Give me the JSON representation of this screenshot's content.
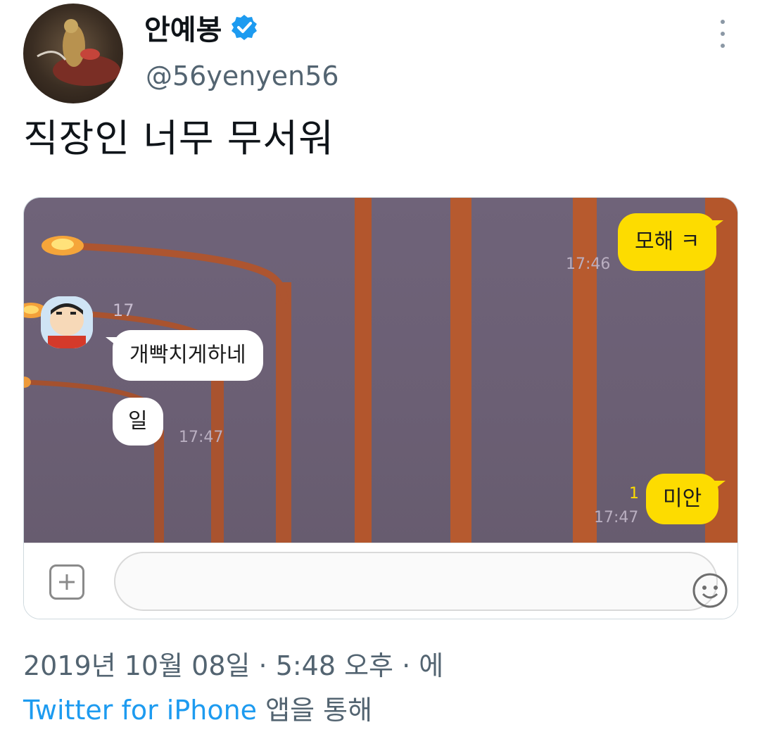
{
  "tweet": {
    "display_name": "안예봉",
    "handle": "@56yenyen56",
    "text": "직장인 너무 무서워",
    "date_line": "2019년 10월 08일 · 5:48 오후 · 에",
    "client": "Twitter for iPhone",
    "via_suffix": " 앱을 통해"
  },
  "chat": {
    "messages": [
      {
        "from": "me",
        "text": "모해 ㅋ",
        "time": "17:46"
      },
      {
        "from": "other",
        "sender": "17",
        "text": "개빡치게하네"
      },
      {
        "from": "other",
        "text": "일",
        "time": "17:47"
      },
      {
        "from": "me",
        "text": "미안",
        "time": "17:47",
        "unread": "1"
      }
    ],
    "input_icons": [
      "plus-icon",
      "emoji-icon",
      "hash-icon"
    ],
    "hash_glyph": "#"
  },
  "colors": {
    "accent_link": "#1d9bf0",
    "verified": "#1d9bf0",
    "my_bubble": "#fddc00",
    "chat_background": "#6f6379"
  }
}
